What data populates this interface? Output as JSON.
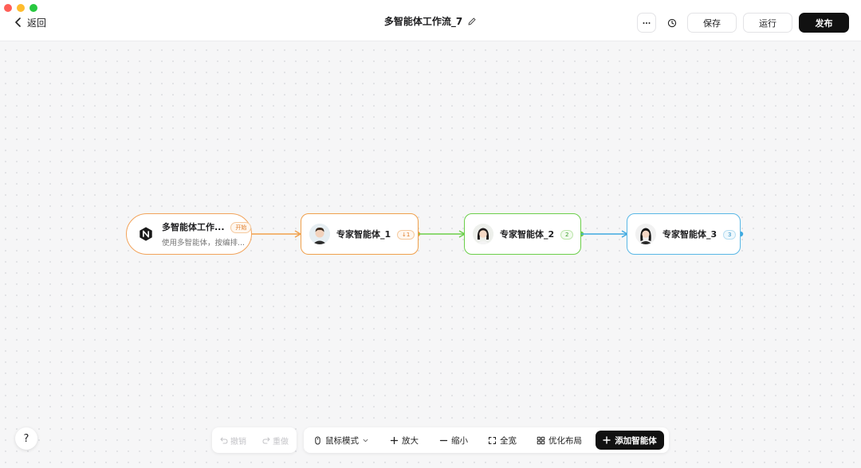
{
  "window": {
    "colors": {
      "close": "#ff5f57",
      "minimize": "#febc2e",
      "zoom": "#28c840"
    }
  },
  "header": {
    "back_label": "返回",
    "title": "多智能体工作流_7",
    "save_label": "保存",
    "run_label": "运行",
    "publish_label": "发布"
  },
  "nodes": {
    "start": {
      "title": "多智能体工作...",
      "badge": "开始",
      "subtitle": "使用多智能体，按编排..."
    },
    "agent1": {
      "title": "专家智能体_1",
      "badge": "↓1"
    },
    "agent2": {
      "title": "专家智能体_2",
      "badge": "2"
    },
    "agent3": {
      "title": "专家智能体_3",
      "badge": "3"
    }
  },
  "edge_colors": {
    "e1": "#f0a04b",
    "e2": "#6bcf4a",
    "e3": "#3fa9e0"
  },
  "toolbar": {
    "undo": "撤销",
    "redo": "重做",
    "mouse_mode": "鼠标模式",
    "zoom_in": "放大",
    "zoom_out": "缩小",
    "fit": "全宽",
    "optimize_layout": "优化布局",
    "add_agent": "添加智能体"
  },
  "help": {
    "label": "?"
  }
}
